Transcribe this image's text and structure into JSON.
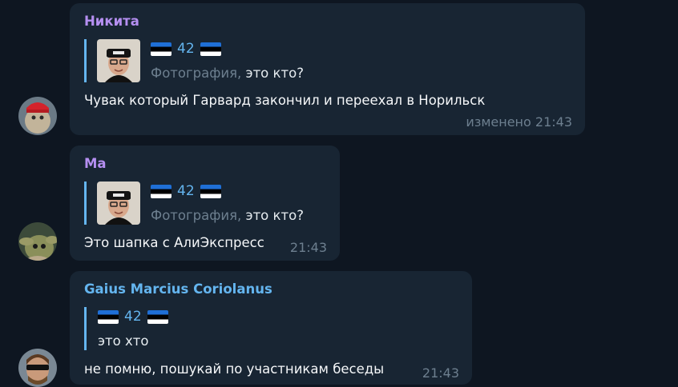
{
  "messages": [
    {
      "sender": "Никита",
      "sender_color": "#b58ff1",
      "reply": {
        "flag_left": "flag-estonia",
        "number": "42",
        "flag_right": "flag-estonia",
        "kind": "Фотография",
        "separator": ",",
        "text": "это кто?"
      },
      "text": "Чувак который Гарвард закончил и переехал в Норильск",
      "time": "изменено 21:43"
    },
    {
      "sender": "Ма",
      "sender_color": "#b58ff1",
      "reply": {
        "flag_left": "flag-estonia",
        "number": "42",
        "flag_right": "flag-estonia",
        "kind": "Фотография",
        "separator": ",",
        "text": "это кто?"
      },
      "text": "Это шапка с АлиЭкспресс",
      "time": "21:43"
    },
    {
      "sender": "Gaius Marcius Coriolanus",
      "sender_color": "#64b5ef",
      "reply": {
        "flag_left": "flag-estonia",
        "number": "42",
        "flag_right": "flag-estonia",
        "text": "это хто"
      },
      "text": "не помню, пошукай по участникам беседы",
      "time": "21:43"
    }
  ]
}
